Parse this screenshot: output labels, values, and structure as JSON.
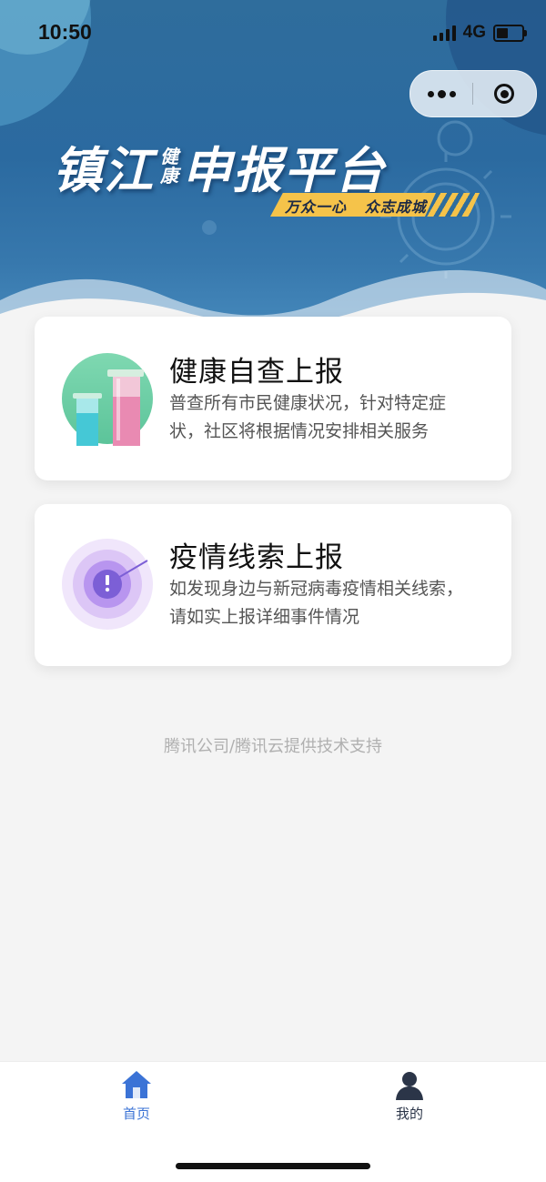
{
  "status_bar": {
    "time": "10:50",
    "network": "4G",
    "signal_icon": "cellular-signal-icon",
    "battery_icon": "battery-icon"
  },
  "mini_program_capsule": {
    "more_icon": "more-dots-icon",
    "close_icon": "circle-target-icon"
  },
  "banner": {
    "title_part1": "镇江",
    "title_small_top": "健",
    "title_small_bottom": "康",
    "title_part2": "申报平台",
    "slogan": "万众一心   众志成城",
    "colors": {
      "background": "#2f6d9c",
      "slogan_bg": "#f5c34a"
    }
  },
  "cards": [
    {
      "title": "健康自查上报",
      "description": "普查所有市民健康状况，针对特定症状，社区将根据情况安排相关服务",
      "icon": "test-tubes-icon"
    },
    {
      "title": "疫情线索上报",
      "description": "如发现身边与新冠病毒疫情相关线索，请如实上报详细事件情况",
      "icon": "radar-alert-icon"
    }
  ],
  "footer_note": "腾讯公司/腾讯云提供技术支持",
  "tab_bar": {
    "items": [
      {
        "label": "首页",
        "icon": "home-icon",
        "active": true
      },
      {
        "label": "我的",
        "icon": "user-icon",
        "active": false
      }
    ],
    "colors": {
      "active": "#3b73d6",
      "inactive": "#2b3548"
    }
  }
}
